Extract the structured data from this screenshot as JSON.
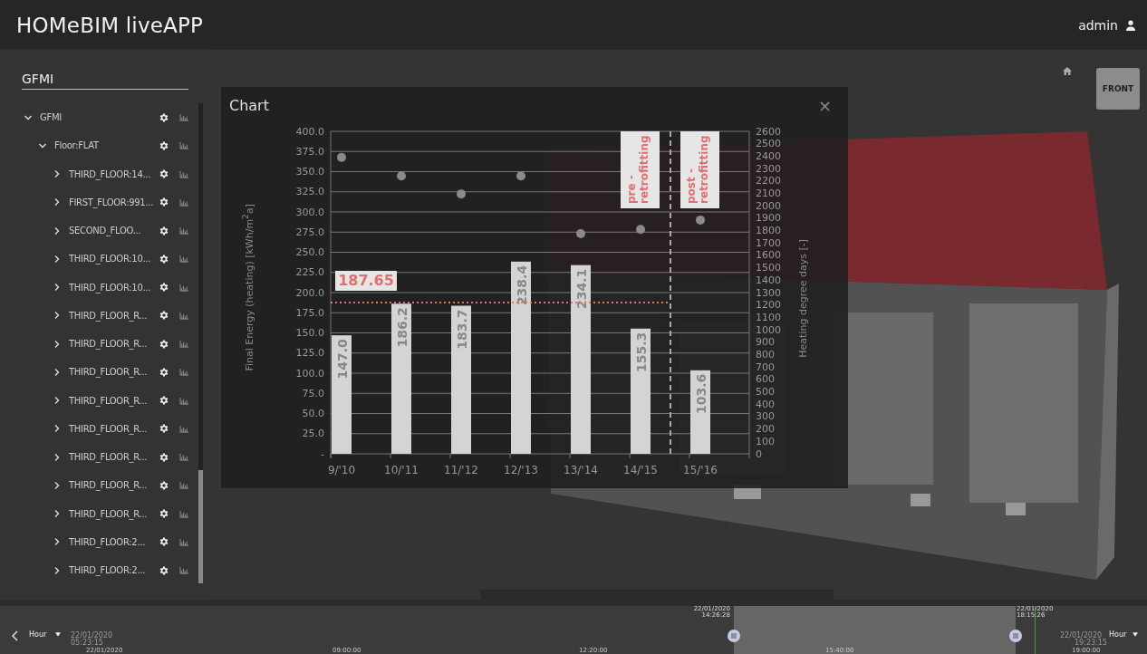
{
  "header": {
    "title": "HOMeBIM liveAPP",
    "user": "admin"
  },
  "sidebar": {
    "search": {
      "value": "GFMI"
    },
    "tree": [
      {
        "label": "GFMI",
        "expanded": true,
        "children": [
          {
            "label": "Floor:FLAT",
            "expanded": true,
            "children": [
              {
                "label": "THIRD_FLOOR:14...",
                "expanded": false
              },
              {
                "label": "FIRST_FLOOR:991...",
                "expanded": false
              },
              {
                "label": "SECOND_FLOO...",
                "expanded": false
              },
              {
                "label": "THIRD_FLOOR:10...",
                "expanded": false
              },
              {
                "label": "THIRD_FLOOR:10...",
                "expanded": false
              },
              {
                "label": "THIRD_FLOOR_R...",
                "expanded": false
              },
              {
                "label": "THIRD_FLOOR_R...",
                "expanded": false
              },
              {
                "label": "THIRD_FLOOR_R...",
                "expanded": false
              },
              {
                "label": "THIRD_FLOOR_R...",
                "expanded": false
              },
              {
                "label": "THIRD_FLOOR_R...",
                "expanded": false
              },
              {
                "label": "THIRD_FLOOR_R...",
                "expanded": false
              },
              {
                "label": "THIRD_FLOOR_R...",
                "expanded": false
              },
              {
                "label": "THIRD_FLOOR_R...",
                "expanded": false
              },
              {
                "label": "THIRD_FLOOR:2...",
                "expanded": false
              },
              {
                "label": "THIRD_FLOOR:2...",
                "expanded": false
              }
            ]
          }
        ]
      }
    ]
  },
  "viewport": {
    "view_cube": "FRONT"
  },
  "chart_dialog": {
    "title": "Chart",
    "close": "×",
    "chart_data": {
      "type": "bar",
      "ylabel": "Final Energy (heating)  [kWh/m$^{2}$a]",
      "y2label": "Heating degree days [-]",
      "categories": [
        "9/'10",
        "10/'11",
        "11/'12",
        "12/'13",
        "13/'14",
        "14/'15",
        "15/'16"
      ],
      "series": [
        {
          "type": "bar",
          "color": "#d4d4d4",
          "values": [
            147.0,
            186.2,
            183.7,
            238.4,
            234.1,
            155.3,
            103.6
          ]
        },
        {
          "type": "scatter",
          "color": "#8a8a8a",
          "axis": "y2",
          "values": [
            2390,
            2240,
            2095,
            2240,
            1775,
            1810,
            1885
          ]
        }
      ],
      "ref_lines": [
        {
          "axis": "y",
          "value": 187.65,
          "label": "187.65"
        }
      ],
      "grid": true,
      "value_labels": [
        "147.0",
        "186.2",
        "183.7",
        "238.4",
        "234.1",
        "155.3",
        "103.6"
      ],
      "ylim": [
        0,
        400
      ],
      "y2lim": [
        0,
        2600
      ],
      "yticks": [
        {
          "value": 0,
          "label": "-"
        },
        {
          "value": 25,
          "label": "25.0"
        },
        {
          "value": 50,
          "label": "50.0"
        },
        {
          "value": 75,
          "label": "75.0"
        },
        {
          "value": 100,
          "label": "100.0"
        },
        {
          "value": 125,
          "label": "125.0"
        },
        {
          "value": 150,
          "label": "150.0"
        },
        {
          "value": 175,
          "label": "175.0"
        },
        {
          "value": 200,
          "label": "200.0"
        },
        {
          "value": 225,
          "label": "225.0"
        },
        {
          "value": 250,
          "label": "250.0"
        },
        {
          "value": 275,
          "label": "275.0"
        },
        {
          "value": 300,
          "label": "300.0"
        },
        {
          "value": 325,
          "label": "325.0"
        },
        {
          "value": 350,
          "label": "350.0"
        },
        {
          "value": 375,
          "label": "375.0"
        },
        {
          "value": 400,
          "label": "400.0"
        }
      ],
      "y2ticks": [
        0,
        100,
        200,
        300,
        400,
        500,
        600,
        700,
        800,
        900,
        1000,
        1100,
        1200,
        1300,
        1400,
        1500,
        1600,
        1700,
        1800,
        1900,
        2000,
        2100,
        2200,
        2300,
        2400,
        2500,
        2600
      ],
      "annotations": [
        "pre -\nretrofitting",
        "post -\nretrofitting"
      ]
    }
  },
  "timeline": {
    "left_unit": "Hour",
    "start_date": "22/01/2020",
    "start_time": "05:23:15",
    "axis_labels": [
      "22/01/2020",
      "09:00:00",
      "12:20:00",
      "15:40:00",
      "19:00:00"
    ],
    "selection_start": {
      "date": "22/01/2020",
      "time": "14:26:28"
    },
    "selection_end": {
      "date": "22/01/2020",
      "time": "18:15:26"
    },
    "right_unit": "Hour",
    "end_date": "22/01/2020",
    "end_time": "19:23:15"
  }
}
